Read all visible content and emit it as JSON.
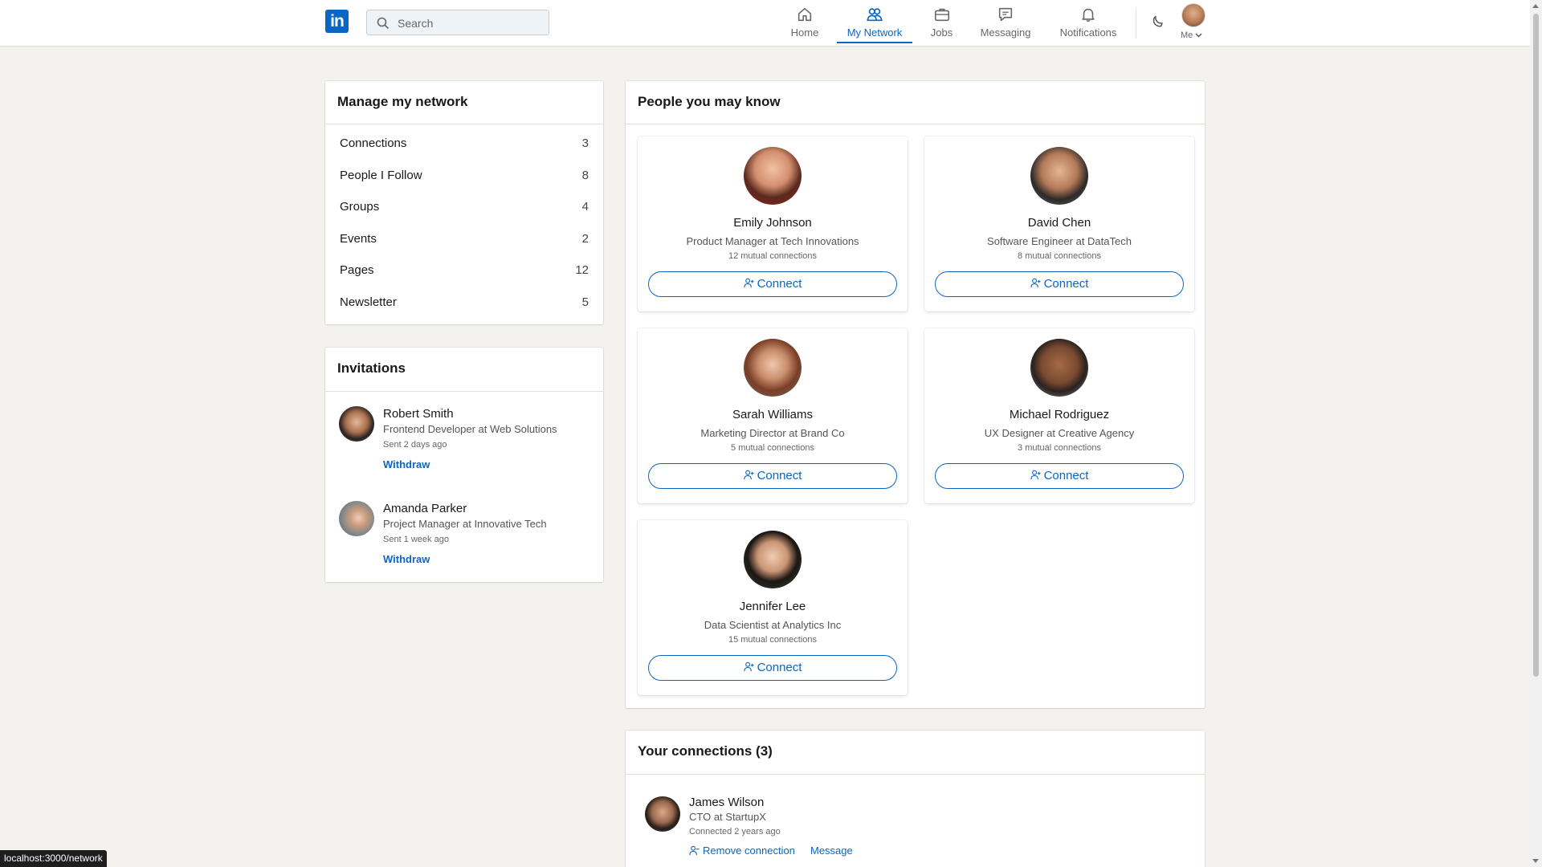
{
  "nav": {
    "logo_text": "in",
    "search_placeholder": "Search",
    "items": [
      {
        "label": "Home",
        "icon": "home-icon"
      },
      {
        "label": "My Network",
        "icon": "network-icon"
      },
      {
        "label": "Jobs",
        "icon": "briefcase-icon"
      },
      {
        "label": "Messaging",
        "icon": "messaging-icon"
      },
      {
        "label": "Notifications",
        "icon": "bell-icon"
      }
    ],
    "active": "My Network",
    "me_label": "Me"
  },
  "manage": {
    "title": "Manage my network",
    "rows": [
      {
        "name": "Connections",
        "count": "3"
      },
      {
        "name": "People I Follow",
        "count": "8"
      },
      {
        "name": "Groups",
        "count": "4"
      },
      {
        "name": "Events",
        "count": "2"
      },
      {
        "name": "Pages",
        "count": "12"
      },
      {
        "name": "Newsletter",
        "count": "5"
      }
    ]
  },
  "invitations": {
    "title": "Invitations",
    "items": [
      {
        "name": "Robert Smith",
        "title": "Frontend Developer at Web Solutions",
        "sent": "Sent 2 days ago",
        "action": "Withdraw"
      },
      {
        "name": "Amanda Parker",
        "title": "Project Manager at Innovative Tech",
        "sent": "Sent 1 week ago",
        "action": "Withdraw"
      }
    ]
  },
  "pymk": {
    "title": "People you may know",
    "connect_label": "Connect",
    "people": [
      {
        "name": "Emily Johnson",
        "title": "Product Manager at Tech Innovations",
        "mutual": "12 mutual connections"
      },
      {
        "name": "David Chen",
        "title": "Software Engineer at DataTech",
        "mutual": "8 mutual connections"
      },
      {
        "name": "Sarah Williams",
        "title": "Marketing Director at Brand Co",
        "mutual": "5 mutual connections"
      },
      {
        "name": "Michael Rodriguez",
        "title": "UX Designer at Creative Agency",
        "mutual": "3 mutual connections"
      },
      {
        "name": "Jennifer Lee",
        "title": "Data Scientist at Analytics Inc",
        "mutual": "15 mutual connections"
      }
    ]
  },
  "connections": {
    "title": "Your connections (3)",
    "items": [
      {
        "name": "James Wilson",
        "title": "CTO at StartupX",
        "since": "Connected 2 years ago",
        "remove": "Remove connection",
        "message": "Message"
      }
    ]
  },
  "status_url": "localhost:3000/network",
  "colors": {
    "accent": "#0a66c2",
    "background": "#f3f2ef"
  }
}
